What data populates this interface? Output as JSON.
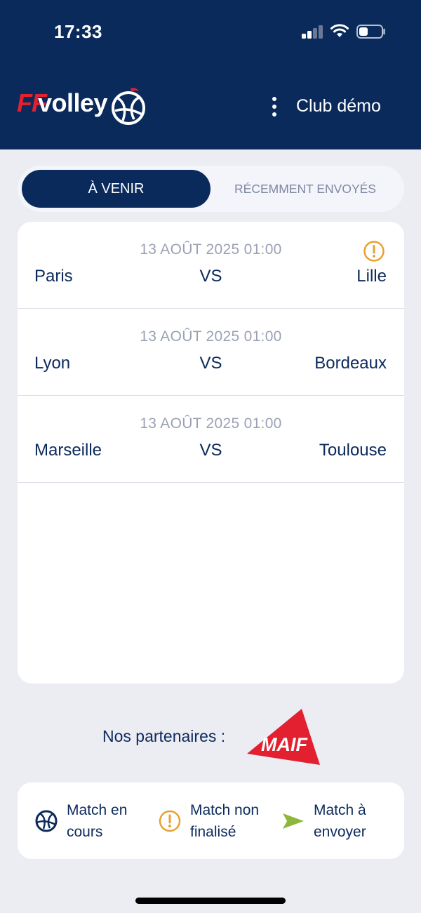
{
  "status_bar": {
    "time": "17:33",
    "signal": "signal-icon",
    "wifi": "wifi-icon",
    "battery": "battery-icon"
  },
  "header": {
    "logo_ff": "FF",
    "logo_volley": "volley",
    "menu_icon": "more-vertical-icon",
    "club_name": "Club démo"
  },
  "tabs": [
    {
      "label": "À VENIR",
      "active": true
    },
    {
      "label": "RÉCEMMENT ENVOYÉS",
      "active": false
    }
  ],
  "matches": [
    {
      "date": "13 AOÛT 2025 01:00",
      "home": "Paris",
      "vs": "VS",
      "away": "Lille",
      "status": "warning-icon"
    },
    {
      "date": "13 AOÛT 2025 01:00",
      "home": "Lyon",
      "vs": "VS",
      "away": "Bordeaux"
    },
    {
      "date": "13 AOÛT 2025 01:00",
      "home": "Marseille",
      "vs": "VS",
      "away": "Toulouse"
    }
  ],
  "partners": {
    "label": "Nos partenaires :",
    "logo": "MAIF"
  },
  "legend": [
    {
      "icon": "volleyball-icon",
      "label": "Match en\ncours"
    },
    {
      "icon": "warning-icon",
      "label": "Match non\nfinalisé"
    },
    {
      "icon": "send-icon",
      "label": "Match à\nenvoyer"
    }
  ],
  "colors": {
    "navy": "#0a2a5c",
    "warning": "#e8a030",
    "send": "#8fb83a",
    "maif_red": "#e2202f"
  }
}
